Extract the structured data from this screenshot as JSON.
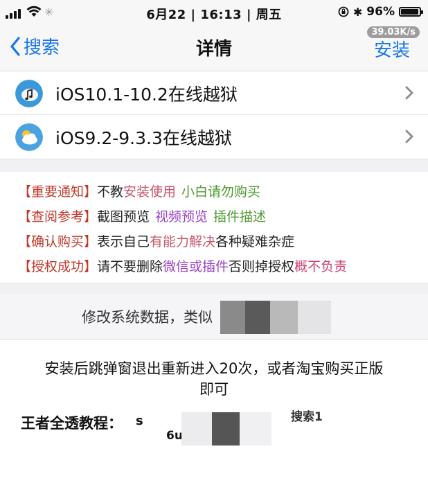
{
  "status_bar": {
    "date_time": "6月22 | 16:13 | 周五",
    "battery_percent": "96%",
    "battery_level": 0.96
  },
  "nav": {
    "back_label": "搜索",
    "title": "详情",
    "speed_badge": "39.03K/s",
    "install_label": "安装"
  },
  "list": {
    "items": [
      {
        "label": "iOS10.1-10.2在线越狱",
        "icon": "music-note-icon"
      },
      {
        "label": "iOS9.2-9.3.3在线越狱",
        "icon": "cloud-sun-icon"
      }
    ]
  },
  "notice": {
    "line1": {
      "tag": "【重要通知】",
      "text1": "不教",
      "text2": "安装使用",
      "text3": "小白请勿购买"
    },
    "line2": {
      "tag": "【查阅参考】",
      "text1": "截图预览",
      "text2": "视频预览",
      "text3": "插件描述"
    },
    "line3": {
      "tag": "【确认购买】",
      "text1": "表示自己",
      "text2": "有能力解决",
      "text3": "各种疑难杂症"
    },
    "line4": {
      "tag": "【授权成功】",
      "text1": "请不要删除",
      "text2": "微信或插件",
      "text3": "否则掉授权",
      "text4": "概不负责"
    }
  },
  "description": {
    "text": "修改系统数据，类似"
  },
  "content": {
    "line1": "安装后跳弹窗退出重新进入20次，或者淘宝购买正版",
    "line2": "即可",
    "guide_label": "王者全透教程：",
    "frag1": "s",
    "frag2": "搜索1",
    "frag3": "6u"
  },
  "colors": {
    "accent": "#1677ea",
    "tag_red": "#c0392b",
    "green": "#4d9a2f",
    "purple": "#9b3fc7"
  }
}
